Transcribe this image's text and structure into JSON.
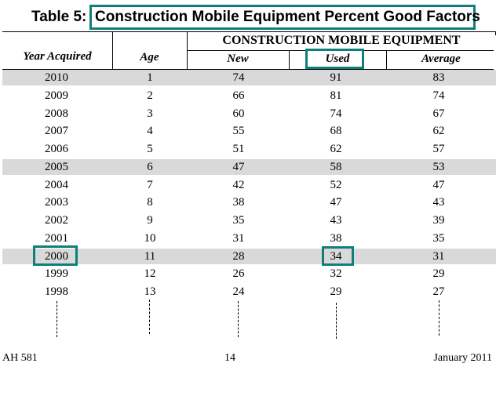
{
  "title": {
    "prefix": "Table 5:",
    "main": "Construction Mobile Equipment Percent Good Factors"
  },
  "table": {
    "headers": {
      "year": "Year Acquired",
      "age": "Age",
      "group": "CONSTRUCTION MOBILE EQUIPMENT",
      "new": "New",
      "used": "Used",
      "average": "Average"
    },
    "rows": [
      {
        "year": "2010",
        "age": "1",
        "new": "74",
        "used": "91",
        "average": "83",
        "shaded": true
      },
      {
        "year": "2009",
        "age": "2",
        "new": "66",
        "used": "81",
        "average": "74",
        "shaded": false
      },
      {
        "year": "2008",
        "age": "3",
        "new": "60",
        "used": "74",
        "average": "67",
        "shaded": false
      },
      {
        "year": "2007",
        "age": "4",
        "new": "55",
        "used": "68",
        "average": "62",
        "shaded": false
      },
      {
        "year": "2006",
        "age": "5",
        "new": "51",
        "used": "62",
        "average": "57",
        "shaded": false
      },
      {
        "year": "2005",
        "age": "6",
        "new": "47",
        "used": "58",
        "average": "53",
        "shaded": true
      },
      {
        "year": "2004",
        "age": "7",
        "new": "42",
        "used": "52",
        "average": "47",
        "shaded": false
      },
      {
        "year": "2003",
        "age": "8",
        "new": "38",
        "used": "47",
        "average": "43",
        "shaded": false
      },
      {
        "year": "2002",
        "age": "9",
        "new": "35",
        "used": "43",
        "average": "39",
        "shaded": false
      },
      {
        "year": "2001",
        "age": "10",
        "new": "31",
        "used": "38",
        "average": "35",
        "shaded": false
      },
      {
        "year": "2000",
        "age": "11",
        "new": "28",
        "used": "34",
        "average": "31",
        "shaded": true
      },
      {
        "year": "1999",
        "age": "12",
        "new": "26",
        "used": "32",
        "average": "29",
        "shaded": false
      },
      {
        "year": "1998",
        "age": "13",
        "new": "24",
        "used": "29",
        "average": "27",
        "shaded": false
      }
    ],
    "continuation": "dashed lines indicate table continues"
  },
  "highlights": {
    "color": "#0f7f7a",
    "items": [
      "title",
      "Used header",
      "2000 year cell",
      "34 used value"
    ]
  },
  "footer": {
    "left": "AH 581",
    "center": "14",
    "right": "January 2011"
  }
}
